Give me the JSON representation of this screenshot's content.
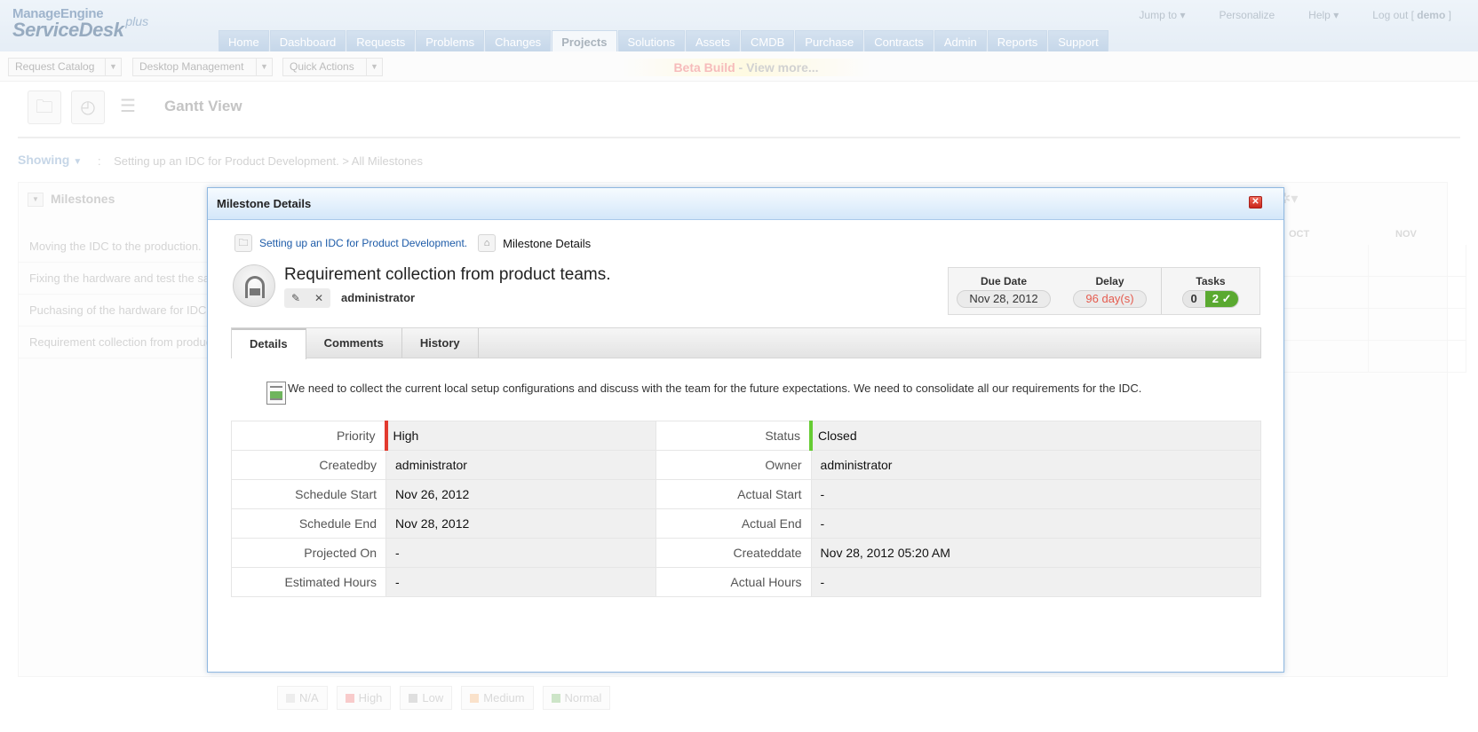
{
  "app": {
    "logo_top": "ManageEngine",
    "logo_main": "ServiceDesk",
    "logo_plus": "plus"
  },
  "nav": {
    "tabs": [
      {
        "label": "Home"
      },
      {
        "label": "Dashboard"
      },
      {
        "label": "Requests"
      },
      {
        "label": "Problems"
      },
      {
        "label": "Changes"
      },
      {
        "label": "Projects"
      },
      {
        "label": "Solutions"
      },
      {
        "label": "Assets"
      },
      {
        "label": "CMDB"
      },
      {
        "label": "Purchase"
      },
      {
        "label": "Contracts"
      },
      {
        "label": "Admin"
      },
      {
        "label": "Reports"
      },
      {
        "label": "Support"
      }
    ],
    "active": "Projects"
  },
  "toplinks": {
    "jump_to": "Jump to",
    "personalize": "Personalize",
    "help": "Help",
    "logout_prefix": "Log out [",
    "user": "demo",
    "logout_suffix": "]"
  },
  "subbar": {
    "request_catalog": "Request Catalog",
    "desktop_management": "Desktop Management",
    "quick_actions": "Quick Actions",
    "beta_label": "Beta Build",
    "beta_link": " - View more..."
  },
  "toolbar": {
    "gantt_title": "Gantt View"
  },
  "showing": {
    "label": "Showing",
    "separator": ":",
    "path": "Setting up an IDC for Product Development. >  All Milestones"
  },
  "milestones_panel": {
    "title": "Milestones",
    "rows": [
      {
        "label": "Moving the IDC to the production."
      },
      {
        "label": "Fixing the hardware and test the same."
      },
      {
        "label": "Puchasing of the hardware for IDC."
      },
      {
        "label": "Requirement collection from product teams."
      }
    ],
    "months": [
      "OCT",
      "NOV"
    ]
  },
  "legend": [
    {
      "label": "N/A",
      "color": "#e0e0e0"
    },
    {
      "label": "High",
      "color": "#f3a5a5"
    },
    {
      "label": "Low",
      "color": "#c9c9c9"
    },
    {
      "label": "Medium",
      "color": "#f6cda6"
    },
    {
      "label": "Normal",
      "color": "#a9d3a0"
    }
  ],
  "modal": {
    "title": "Milestone Details",
    "breadcrumb_project": "Setting up an IDC for Product Development.",
    "breadcrumb_current": "Milestone Details",
    "milestone_title": "Requirement collection from product teams.",
    "owner": "administrator",
    "due_date_label": "Due Date",
    "due_date": "Nov 28, 2012",
    "delay_label": "Delay",
    "delay": "96 day(s)",
    "tasks_label": "Tasks",
    "tasks_open": "0",
    "tasks_closed": "2",
    "tabs": [
      {
        "label": "Details"
      },
      {
        "label": "Comments"
      },
      {
        "label": "History"
      }
    ],
    "description": "We need to collect the current local setup configurations and discuss with the team for the future expectations. We need to consolidate all our requirements for the IDC.",
    "fields": [
      {
        "l_label": "Priority",
        "l_value": "High",
        "r_label": "Status",
        "r_value": "Closed"
      },
      {
        "l_label": "Createdby",
        "l_value": "administrator",
        "r_label": "Owner",
        "r_value": "administrator"
      },
      {
        "l_label": "Schedule Start",
        "l_value": "Nov 26, 2012",
        "r_label": "Actual Start",
        "r_value": "-"
      },
      {
        "l_label": "Schedule End",
        "l_value": "Nov 28, 2012",
        "r_label": "Actual End",
        "r_value": "-"
      },
      {
        "l_label": "Projected On",
        "l_value": "-",
        "r_label": "Createddate",
        "r_value": "Nov 28, 2012 05:20 AM"
      },
      {
        "l_label": "Estimated Hours",
        "l_value": "-",
        "r_label": "Actual Hours",
        "r_value": "-"
      }
    ],
    "colors": {
      "priority_high": "#e23a2f",
      "status_closed": "#66cc33",
      "tasks_done": "#5aa930",
      "link": "#1d5ba8"
    }
  }
}
